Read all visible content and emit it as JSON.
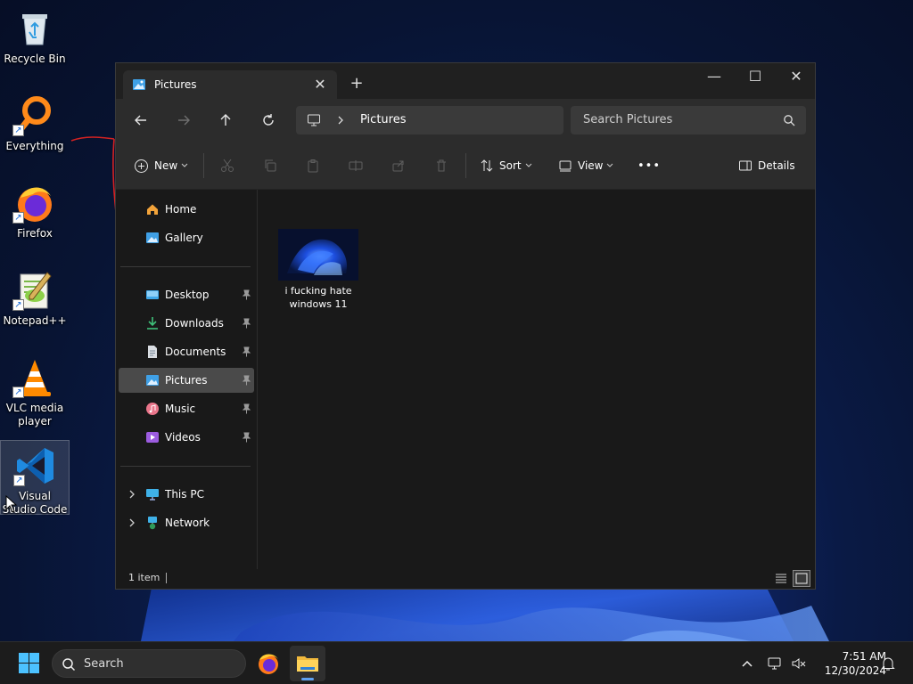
{
  "desktop": {
    "icons": [
      {
        "label": "Recycle Bin",
        "icon": "recycle-bin-icon"
      },
      {
        "label": "Everything",
        "icon": "everything-search-icon"
      },
      {
        "label": "Firefox",
        "icon": "firefox-icon"
      },
      {
        "label": "Notepad++",
        "icon": "notepadpp-icon"
      },
      {
        "label": "VLC media player",
        "icon": "vlc-icon"
      },
      {
        "label": "Visual Studio Code",
        "icon": "vscode-icon"
      }
    ]
  },
  "explorer": {
    "tab_title": "Pictures",
    "tab_close": "✕",
    "new_tab": "+",
    "controls": {
      "minimize": "—",
      "maximize": "☐",
      "close": "✕"
    },
    "address_crumb": "Pictures",
    "search_placeholder": "Search Pictures",
    "toolbar": {
      "new_label": "New",
      "sort_label": "Sort",
      "view_label": "View",
      "more_label": "•••",
      "details_label": "Details"
    },
    "sidebar": {
      "quick": [
        {
          "label": "Home",
          "icon": "home-icon"
        },
        {
          "label": "Gallery",
          "icon": "gallery-icon"
        }
      ],
      "pinned": [
        {
          "label": "Desktop",
          "icon": "desktop-folder-icon"
        },
        {
          "label": "Downloads",
          "icon": "downloads-folder-icon"
        },
        {
          "label": "Documents",
          "icon": "documents-folder-icon"
        },
        {
          "label": "Pictures",
          "icon": "pictures-folder-icon",
          "active": true
        },
        {
          "label": "Music",
          "icon": "music-folder-icon"
        },
        {
          "label": "Videos",
          "icon": "videos-folder-icon"
        }
      ],
      "locations": [
        {
          "label": "This PC",
          "icon": "this-pc-icon"
        },
        {
          "label": "Network",
          "icon": "network-icon"
        }
      ]
    },
    "files": [
      {
        "name": "i fucking hate windows 11"
      }
    ],
    "status_count": "1 item"
  },
  "taskbar": {
    "search_placeholder": "Search",
    "time": "7:51 AM",
    "date": "12/30/2024"
  },
  "colors": {
    "window_bg": "#191919",
    "chrome_bg": "#2c2c2c",
    "accent": "#5ea0ef",
    "selection": "#4a4a4a"
  }
}
